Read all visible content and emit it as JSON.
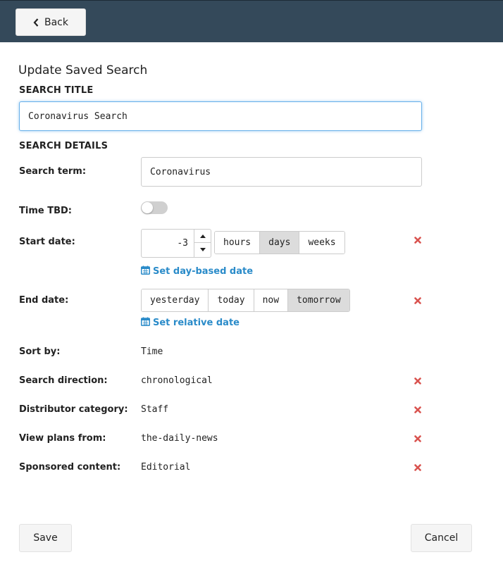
{
  "header": {
    "back_label": "Back"
  },
  "form": {
    "heading": "Update Saved Search",
    "title_section_label": "SEARCH TITLE",
    "title_value": "Coronavirus Search",
    "details_section_label": "SEARCH DETAILS",
    "search_term": {
      "label": "Search term:",
      "value": "Coronavirus"
    },
    "time_tbd": {
      "label": "Time TBD:",
      "enabled": false
    },
    "start_date": {
      "label": "Start date:",
      "value": "-3",
      "units": [
        "hours",
        "days",
        "weeks"
      ],
      "selected_unit": "days",
      "link_label": "Set day-based date"
    },
    "end_date": {
      "label": "End date:",
      "options": [
        "yesterday",
        "today",
        "now",
        "tomorrow"
      ],
      "selected": "tomorrow",
      "link_label": "Set relative date"
    },
    "sort_by": {
      "label": "Sort by:",
      "value": "Time"
    },
    "search_direction": {
      "label": "Search direction:",
      "value": "chronological"
    },
    "distributor_category": {
      "label": "Distributor category:",
      "value": "Staff"
    },
    "view_plans_from": {
      "label": "View plans from:",
      "value": "the-daily-news"
    },
    "sponsored_content": {
      "label": "Sponsored content:",
      "value": "Editorial"
    }
  },
  "footer": {
    "save_label": "Save",
    "cancel_label": "Cancel"
  },
  "colors": {
    "header_bg": "#34495a",
    "link": "#2a8bc9",
    "remove": "#d9534f",
    "active_segment": "#dcdcdc",
    "focus_border": "#66afe9"
  },
  "icons": {
    "back": "chevron-left-icon",
    "calendar": "calendar-icon",
    "remove": "close-icon",
    "spin_up": "caret-up-icon",
    "spin_down": "caret-down-icon"
  }
}
